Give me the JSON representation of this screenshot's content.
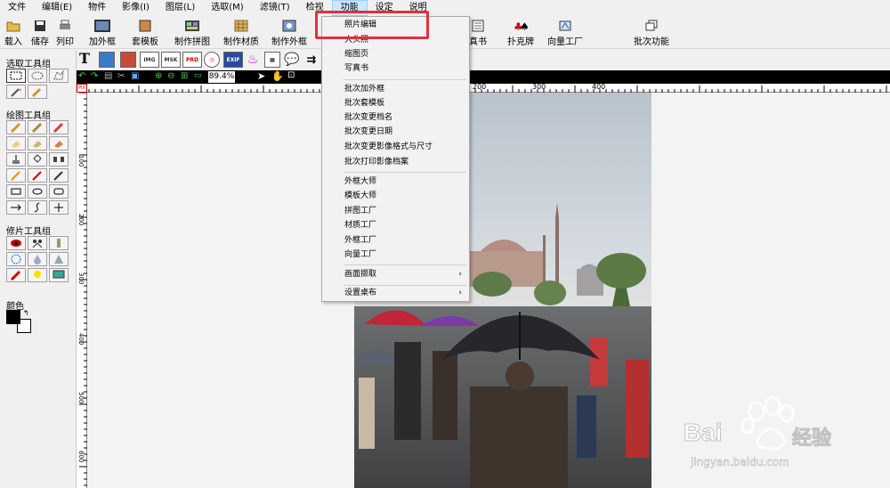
{
  "menubar": {
    "items": [
      {
        "label": "文件"
      },
      {
        "label": "编辑(E)"
      },
      {
        "label": "物件"
      },
      {
        "label": "影像(I)"
      },
      {
        "label": "图层(L)"
      },
      {
        "label": "选取(M)"
      },
      {
        "label": "滤镜(T)"
      },
      {
        "label": "检视"
      },
      {
        "label": "功能"
      },
      {
        "label": "设定"
      },
      {
        "label": "说明"
      }
    ]
  },
  "toolbar": {
    "load": "载入",
    "save": "储存",
    "print": "列印",
    "add_frame": "加外框",
    "template": "套模板",
    "collage": "制作拼图",
    "material": "制作材质",
    "make_frame": "制作外框",
    "book": "真书",
    "poker": "扑克牌",
    "vector": "向量工厂",
    "batch": "批次功能"
  },
  "toolbar2": {
    "text_tool": "T",
    "img_label": "IMG",
    "msk_label": "MSK",
    "prd_label": "PRD",
    "exif_label": "EXIF"
  },
  "zoom": {
    "value": "89.4%"
  },
  "leftpanel": {
    "select_group": "选取工具组",
    "draw_group": "绘图工具组",
    "retouch_group": "修片工具组",
    "color_label": "颜色"
  },
  "ruler_top": {
    "ticks": [
      "200",
      "300",
      "400"
    ]
  },
  "ruler_left": {
    "ticks": [
      "100",
      "200",
      "300",
      "400",
      "500",
      "600"
    ]
  },
  "dropdown": {
    "items": [
      {
        "label": "照片编辑"
      },
      {
        "label": "大头照"
      },
      {
        "label": "缩图页"
      },
      {
        "label": "写真书"
      },
      {
        "label": "批次加外框"
      },
      {
        "label": "批次套模板"
      },
      {
        "label": "批次变更档名"
      },
      {
        "label": "批次变更日期"
      },
      {
        "label": "批次变更影像格式与尺寸"
      },
      {
        "label": "批次打印影像档案"
      },
      {
        "label": "外框大师"
      },
      {
        "label": "模板大师"
      },
      {
        "label": "拼图工厂"
      },
      {
        "label": "材质工厂"
      },
      {
        "label": "外框工厂"
      },
      {
        "label": "向量工厂"
      },
      {
        "label": "画面撷取"
      },
      {
        "label": "设置桌布"
      }
    ]
  },
  "watermark": {
    "brand": "Bai",
    "brand_cn": "经验",
    "url": "jingyan.baidu.com"
  },
  "colors": {
    "highlight": "#e0313a",
    "menu_active": "#cce8ff"
  }
}
